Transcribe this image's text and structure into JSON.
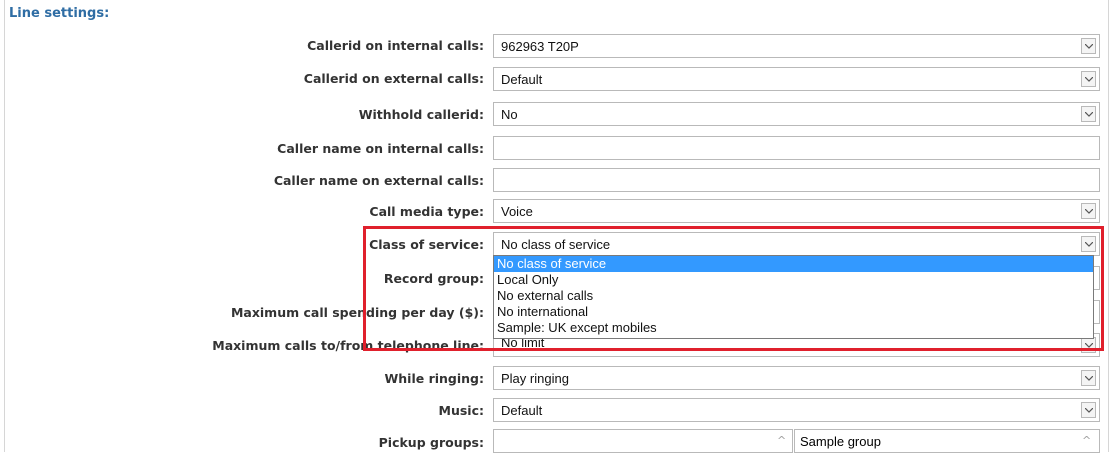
{
  "section": {
    "title": "Line settings:"
  },
  "rows": [
    {
      "label": "Callerid on internal calls:",
      "value": "962963 T20P"
    },
    {
      "label": "Callerid on external calls:",
      "value": "Default"
    },
    {
      "label": "Withhold callerid:",
      "value": "No"
    },
    {
      "label": "Caller name on internal calls:",
      "value": ""
    },
    {
      "label": "Caller name on external calls:",
      "value": ""
    },
    {
      "label": "Call media type:",
      "value": "Voice"
    },
    {
      "label": "Class of service:",
      "value": "No class of service"
    },
    {
      "label": "Record group:",
      "value": ""
    },
    {
      "label": "Maximum call spending per day ($):",
      "value": ""
    },
    {
      "label": "Maximum calls to/from telephone line:",
      "value": "No limit"
    },
    {
      "label": "While ringing:",
      "value": "Play ringing"
    },
    {
      "label": "Music:",
      "value": "Default"
    },
    {
      "label": "Pickup groups:",
      "value": ""
    }
  ],
  "class_of_service_options": [
    "No class of service",
    "Local Only",
    "No external calls",
    "No international",
    "Sample: UK except mobiles"
  ],
  "pickup_groups": {
    "available": "Sample group"
  },
  "colors": {
    "highlight": "#e0202c",
    "selection": "#3399ff",
    "title": "#2f6da4"
  }
}
